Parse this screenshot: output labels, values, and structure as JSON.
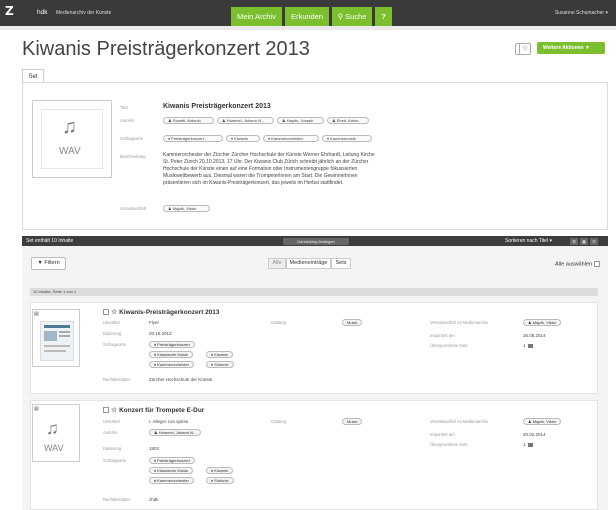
{
  "topbar": {
    "logo": "Z",
    "brand": "hdk",
    "app_name": "Medienarchiv der Künste",
    "nav": [
      "Mein Archiv",
      "Erkunden",
      "Suche",
      "?"
    ],
    "user": "Susanne Schumacher ▾"
  },
  "page": {
    "title": "Kiwanis Preisträgerkonzert 2013",
    "actions_label": "Weitere Aktionen ▼",
    "tab": "Set"
  },
  "detail": {
    "thumb_label": "WAV",
    "fields": {
      "titel_label": "Titel",
      "titel": "Kiwanis Preisträgerkonzert 2013",
      "autoren_label": "Autor/in",
      "autoren": [
        "Rosetti, Antonio",
        "Hummel, Johann N...",
        "Haydn, Joseph",
        "Eberl, Anton"
      ],
      "schlagworte_label": "Schlagworte",
      "schlagworte": [
        "Preisträgerkonzert",
        "Kiwanis",
        "Kammerorchester",
        "Kammermusik"
      ],
      "beschreibung_label": "Beschreibung",
      "beschreibung": [
        "Kammerorchester der Zürcher Zürcher Hochschule der Künste Werner Ehrhardt, Leitung Kirche",
        "St. Peter Zürich 20.10.2013, 17 Uhr. Der Kiwanis Club Zürich schreibt jährlich an der Zürcher",
        "Hochschule der Künste einen auf eine Formation oder Instrumentengruppe fokussierten",
        "Musikwettbewerb aus. Diesmal waren die TrompeterInnen am Start. Die GewinnerInnen",
        "präsentieren sich im Kiwanis-Preisträgerkonzert, das jeweils im Herbst stattfindet."
      ],
      "verantwortlich_label": "Verantwortlich",
      "verantwortlich": "Majzik, Viktor"
    }
  },
  "toolbar": {
    "count": "Set enthält 10 Inhalte",
    "show_label": "Darstellung festlegen",
    "sort_label": "Sortieren nach Titel ▾"
  },
  "filter": {
    "button": "Filtern",
    "segments": [
      "Alle",
      "Medieneinträge",
      "Sets"
    ],
    "select_all": "Alle auswählen"
  },
  "list": {
    "page_header": "10 Inhalte, Seite 1 von 1",
    "items": [
      {
        "title": "Kiwanis-Preisträgerkonzert 2013",
        "rows": [
          {
            "label": "Untertitel",
            "value": "Flyer"
          },
          {
            "label": "Datierung",
            "value": "20.10.2013"
          },
          {
            "label": "Schlagworte",
            "value": ""
          }
        ],
        "tags": [
          "Preisträgerkonzert",
          "Klassische Musik",
          "Kiwanis",
          "Kammerorchester",
          "Sinfonie"
        ],
        "rechteinhaber_label": "Rechteinhaber",
        "rechteinhaber": "Zürcher Hochschule der Künste",
        "gattung_label": "Gattung",
        "gattung": "Musik",
        "verantwortlich_label": "Verantwortlich im Medienarchiv",
        "verantwortlich": "Majzik, Viktor",
        "importiert_label": "Importiert am",
        "importiert": "26.05.2014",
        "sets_label": "Übergeordnete Sets",
        "sets": "1"
      },
      {
        "title": "Konzert für Trompete E-Dur",
        "thumb_label": "WAV",
        "rows": [
          {
            "label": "Untertitel",
            "value": "I. Allegro con spirito"
          },
          {
            "label": "Autor/in",
            "value": ""
          },
          {
            "label": "Datierung",
            "value": "1803"
          },
          {
            "label": "Schlagworte",
            "value": ""
          }
        ],
        "autor": "Hummel, Johann N...",
        "tags": [
          "Preisträgerkonzert",
          "Klassische Musik",
          "Kiwanis",
          "Kammerorchester",
          "Sinfonie"
        ],
        "rechteinhaber_label": "Rechteinhaber",
        "rechteinhaber": "zhdk",
        "gattung_label": "Gattung",
        "gattung": "Musik",
        "verantwortlich_label": "Verantwortlich im Medienarchiv",
        "verantwortlich": "Majzik, Viktor",
        "importiert_label": "Importiert am",
        "importiert": "20.02.2014",
        "sets_label": "Übergeordnete Sets",
        "sets": "1"
      }
    ]
  },
  "colors": {
    "accent": "#7cbf2e",
    "topbar": "#3a3a3a",
    "toolbar": "#3d3d3d"
  }
}
